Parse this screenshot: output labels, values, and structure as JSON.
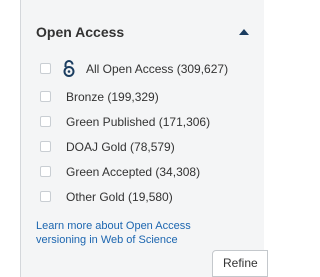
{
  "panel": {
    "title": "Open Access",
    "collapse_icon": "chevron-up-icon"
  },
  "filters": [
    {
      "label": "All Open Access (309,627)",
      "icon": "open-access-icon"
    },
    {
      "label": "Bronze (199,329)"
    },
    {
      "label": "Green Published (171,306)"
    },
    {
      "label": "DOAJ Gold (78,579)"
    },
    {
      "label": "Green Accepted (34,308)"
    },
    {
      "label": "Other Gold (19,580)"
    }
  ],
  "learn_more": "Learn more about Open Access versioning in Web of Science",
  "refine_label": "Refine",
  "colors": {
    "panel_bg": "#f4f5f6",
    "link": "#1c66b0",
    "oa_icon": "#1b3d60"
  }
}
